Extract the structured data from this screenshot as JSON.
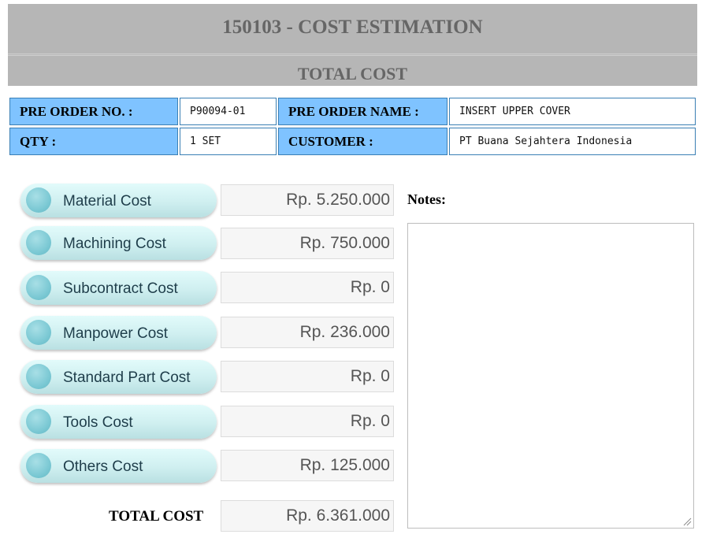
{
  "header": {
    "title": "150103 - COST ESTIMATION",
    "subtitle": "TOTAL COST"
  },
  "info": {
    "pre_order_no_label": "PRE ORDER NO. :",
    "pre_order_no": "P90094-01",
    "pre_order_name_label": "PRE ORDER NAME :",
    "pre_order_name": "INSERT UPPER COVER",
    "qty_label": "QTY :",
    "qty": "1 SET",
    "customer_label": "CUSTOMER :",
    "customer": "PT Buana Sejahtera Indonesia"
  },
  "costs": [
    {
      "label": "Material Cost",
      "amount": "Rp. 5.250.000"
    },
    {
      "label": "Machining Cost",
      "amount": "Rp. 750.000"
    },
    {
      "label": "Subcontract Cost",
      "amount": "Rp. 0"
    },
    {
      "label": "Manpower Cost",
      "amount": "Rp. 236.000"
    },
    {
      "label": "Standard Part Cost",
      "amount": "Rp. 0"
    },
    {
      "label": "Tools Cost",
      "amount": "Rp. 0"
    },
    {
      "label": "Others Cost",
      "amount": "Rp. 125.000"
    }
  ],
  "total": {
    "label": "TOTAL COST",
    "amount": "Rp. 6.361.000"
  },
  "notes": {
    "label": "Notes:",
    "value": ""
  },
  "colors": {
    "header_bg": "#b6b6b6",
    "label_cell_bg": "#7fc3ff",
    "pill_bg": "#cfeff0"
  }
}
